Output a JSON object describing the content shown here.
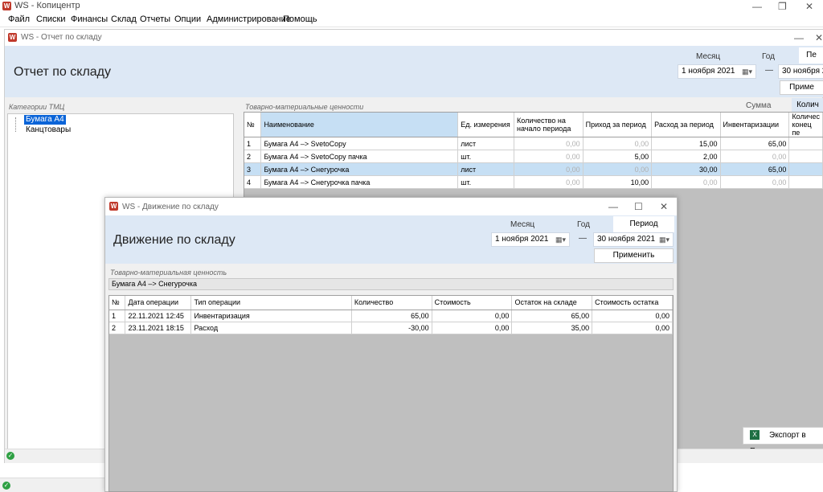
{
  "app": {
    "logo_text": "W",
    "title": "WS - Копицентр",
    "minimize": "—",
    "restore": "❐",
    "close": "✕"
  },
  "menu": [
    "Файл",
    "Списки",
    "Финансы",
    "Склад",
    "Отчеты",
    "Опции",
    "Администрирование",
    "Помощь"
  ],
  "report_window": {
    "title": "WS - Отчет по складу",
    "minimize": "—",
    "close": "✕",
    "heading": "Отчет по складу",
    "month_label": "Месяц",
    "year_label": "Год",
    "period_tab": "Пе",
    "date_from": "1  ноября  2021",
    "date_dash": "—",
    "date_to": "30  ноября  2",
    "apply_label": "Приме",
    "categories_label": "Категории ТМЦ",
    "categories": [
      "Бумага А4",
      "Канцтовары"
    ],
    "goods_label": "Товарно-материальные ценности",
    "sum_label": "Сумма",
    "qty_tab": "Колич",
    "columns": [
      "№",
      "Наименование",
      "Ед. измерения",
      "Количество на начало периода",
      "Приход за период",
      "Расход за период",
      "Инвентаризации",
      "Количес конец пе"
    ],
    "rows": [
      [
        "1",
        "Бумага А4 –> SvetoCopy",
        "лист",
        "0,00",
        "0,00",
        "15,00",
        "65,00"
      ],
      [
        "2",
        "Бумага А4 –> SvetoCopy пачка",
        "шт.",
        "0,00",
        "5,00",
        "2,00",
        "0,00"
      ],
      [
        "3",
        "Бумага А4 –> Снегурочка",
        "лист",
        "0,00",
        "0,00",
        "30,00",
        "65,00"
      ],
      [
        "4",
        "Бумага А4 –> Снегурочка пачка",
        "шт.",
        "0,00",
        "10,00",
        "0,00",
        "0,00"
      ]
    ],
    "export_label": "Экспорт в Exce",
    "status_icon": "✓"
  },
  "movement_window": {
    "title": "WS - Движение по складу",
    "minimize": "—",
    "maximize": "☐",
    "close": "✕",
    "heading": "Движение по складу",
    "month_label": "Месяц",
    "year_label": "Год",
    "period_tab": "Период",
    "date_from": "1  ноября  2021",
    "date_dash": "—",
    "date_to": "30  ноября  2021",
    "apply_label": "Применить",
    "item_label": "Товарно-материальная ценность",
    "item_value": "Бумага А4 –> Снегурочка",
    "columns": [
      "№",
      "Дата операции",
      "Тип операции",
      "Количество",
      "Стоимость",
      "Остаток на складе",
      "Стоимость остатка"
    ],
    "rows": [
      [
        "1",
        "22.11.2021 12:45",
        "Инвентаризация",
        "65,00",
        "0,00",
        "65,00",
        "0,00"
      ],
      [
        "2",
        "23.11.2021 18:15",
        "Расход",
        "-30,00",
        "0,00",
        "35,00",
        "0,00"
      ]
    ]
  },
  "bottom_status_icon": "✓"
}
